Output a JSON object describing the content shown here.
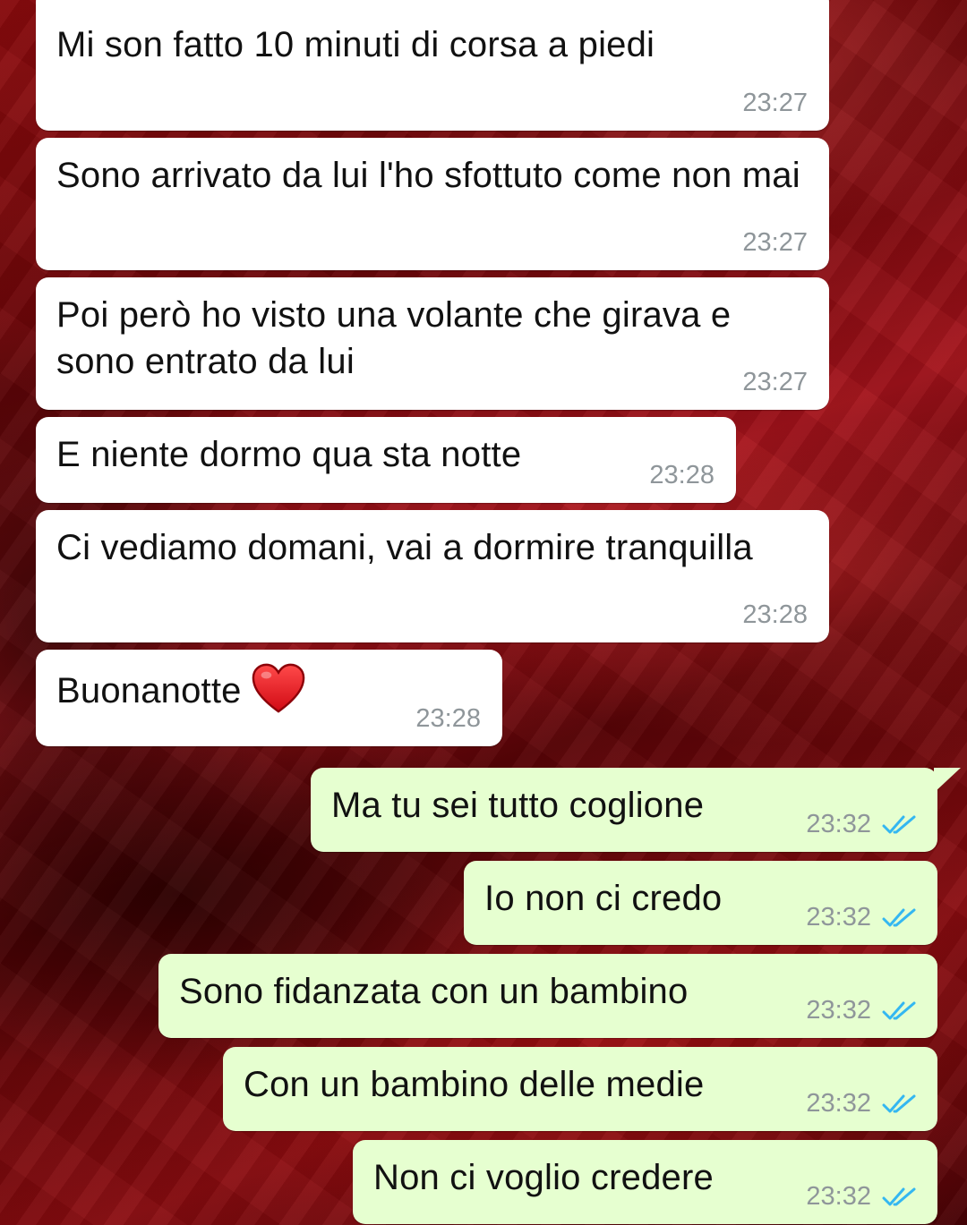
{
  "messages": [
    {
      "dir": "in",
      "text": "Mi son fatto 10 minuti di corsa a piedi",
      "time": "23:27"
    },
    {
      "dir": "in",
      "text": "Sono arrivato da lui l'ho sfottuto come non mai",
      "time": "23:27"
    },
    {
      "dir": "in",
      "text": "Poi però ho visto una volante che girava e sono entrato da lui",
      "time": "23:27"
    },
    {
      "dir": "in",
      "text": "E niente dormo qua sta notte",
      "time": "23:28"
    },
    {
      "dir": "in",
      "text": "Ci vediamo domani, vai a dormire tranquilla",
      "time": "23:28"
    },
    {
      "dir": "in",
      "text": "Buonanotte",
      "emoji": "red-heart",
      "time": "23:28"
    },
    {
      "dir": "out",
      "text": "Ma tu sei tutto coglione",
      "time": "23:32",
      "status": "read"
    },
    {
      "dir": "out",
      "text": "Io non ci credo",
      "time": "23:32",
      "status": "read"
    },
    {
      "dir": "out",
      "text": "Sono fidanzata con un bambino",
      "time": "23:32",
      "status": "read"
    },
    {
      "dir": "out",
      "text": "Con un bambino delle medie",
      "time": "23:32",
      "status": "read"
    },
    {
      "dir": "out",
      "text": "Non ci voglio credere",
      "time": "23:32",
      "status": "read"
    }
  ],
  "colors": {
    "incoming_bubble": "#ffffff",
    "outgoing_bubble": "#e6ffd0",
    "timestamp": "#8f969a",
    "read_ticks": "#34b7f1",
    "wallpaper": "#8e0b0e"
  },
  "icons": {
    "read_status": "double-check-icon",
    "emoji": "red-heart-icon"
  }
}
